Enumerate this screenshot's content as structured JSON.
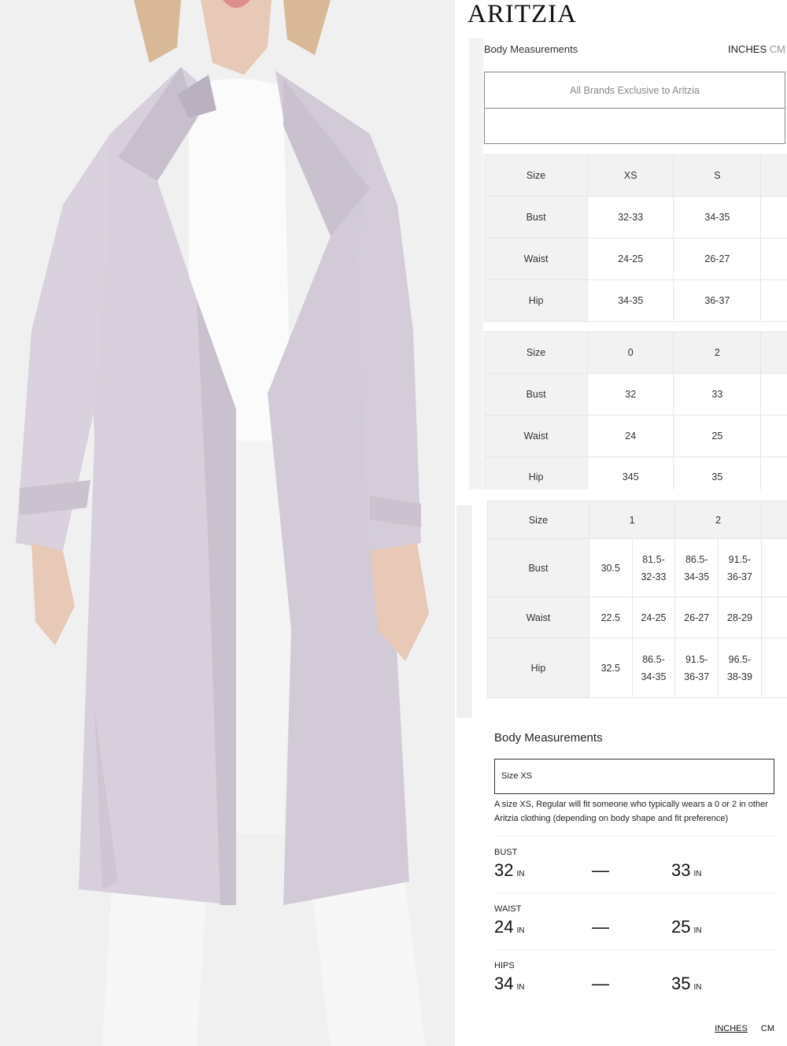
{
  "brand": "ARITZIA",
  "measurements_header": {
    "title": "Body Measurements",
    "unit_active": "INCHES",
    "unit_inactive": "CM"
  },
  "brands_banner": "All Brands Exclusive to Aritzia",
  "table_letter": {
    "rows": [
      [
        "Size",
        "XS",
        "S"
      ],
      [
        "Bust",
        "32-33",
        "34-35"
      ],
      [
        "Waist",
        "24-25",
        "26-27"
      ],
      [
        "Hip",
        "34-35",
        "36-37"
      ]
    ]
  },
  "table_numeric": {
    "rows": [
      [
        "Size",
        "0",
        "2"
      ],
      [
        "Bust",
        "32",
        "33"
      ],
      [
        "Waist",
        "24",
        "25"
      ],
      [
        "Hip",
        "345",
        "35"
      ]
    ]
  },
  "table_cm": {
    "header": [
      "Size",
      "1",
      "2"
    ],
    "rows": [
      [
        "Bust",
        "30.5",
        "81.5-\n32-33",
        "86.5-\n34-35",
        "91.5-\n36-37"
      ],
      [
        "Waist",
        "22.5",
        "24-25",
        "26-27",
        "28-29"
      ],
      [
        "Hip",
        "32.5",
        "86.5-\n34-35",
        "91.5-\n36-37",
        "96.5-\n38-39"
      ]
    ]
  },
  "size_detail": {
    "title": "Body Measurements",
    "selected_size": "Size XS",
    "description": "A size XS, Regular will fit someone who typically wears a 0 or 2 in other Aritzia clothing (depending on body shape and fit preference)",
    "measurements": [
      {
        "label": "BUST",
        "low": "32",
        "high": "33",
        "unit": "IN"
      },
      {
        "label": "WAIST",
        "low": "24",
        "high": "25",
        "unit": "IN"
      },
      {
        "label": "HIPS",
        "low": "34",
        "high": "35",
        "unit": "IN"
      }
    ],
    "separator": "—",
    "unit_active": "INCHES",
    "unit_inactive": "CM"
  }
}
